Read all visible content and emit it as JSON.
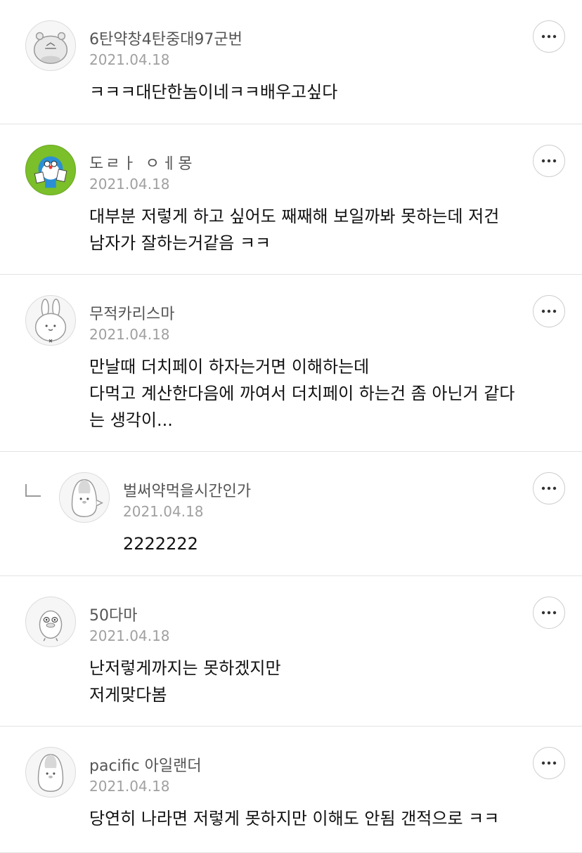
{
  "comments": [
    {
      "nick": "6탄약창4탄중대97군번",
      "date": "2021.04.18",
      "lines": [
        "ㅋㅋㅋ대단한놈이네ㅋㅋ배우고싶다"
      ]
    },
    {
      "nick": "도ㄹㅏ ㅇㅔ몽",
      "date": "2021.04.18",
      "lines": [
        "대부분 저렇게 하고 싶어도 째째해 보일까봐 못하는데 저건",
        "남자가 잘하는거같음 ㅋㅋ"
      ]
    },
    {
      "nick": "무적카리스마",
      "date": "2021.04.18",
      "lines": [
        "만날때 더치페이 하자는거면 이해하는데",
        "다먹고 계산한다음에 까여서 더치페이 하는건 좀 아닌거 같다",
        "는 생각이..."
      ]
    },
    {
      "nick": "벌써약먹을시간인가",
      "date": "2021.04.18",
      "lines": [
        "2222222"
      ],
      "reply": true
    },
    {
      "nick": "50다마",
      "date": "2021.04.18",
      "lines": [
        "난저렇게까지는 못하겠지만",
        "저게맞다봄"
      ]
    },
    {
      "nick": "pacific 아일랜더",
      "date": "2021.04.18",
      "lines": [
        "당연히 나라면 저렇게 못하지만 이해도 안됨 갠적으로 ㅋㅋ"
      ]
    }
  ]
}
